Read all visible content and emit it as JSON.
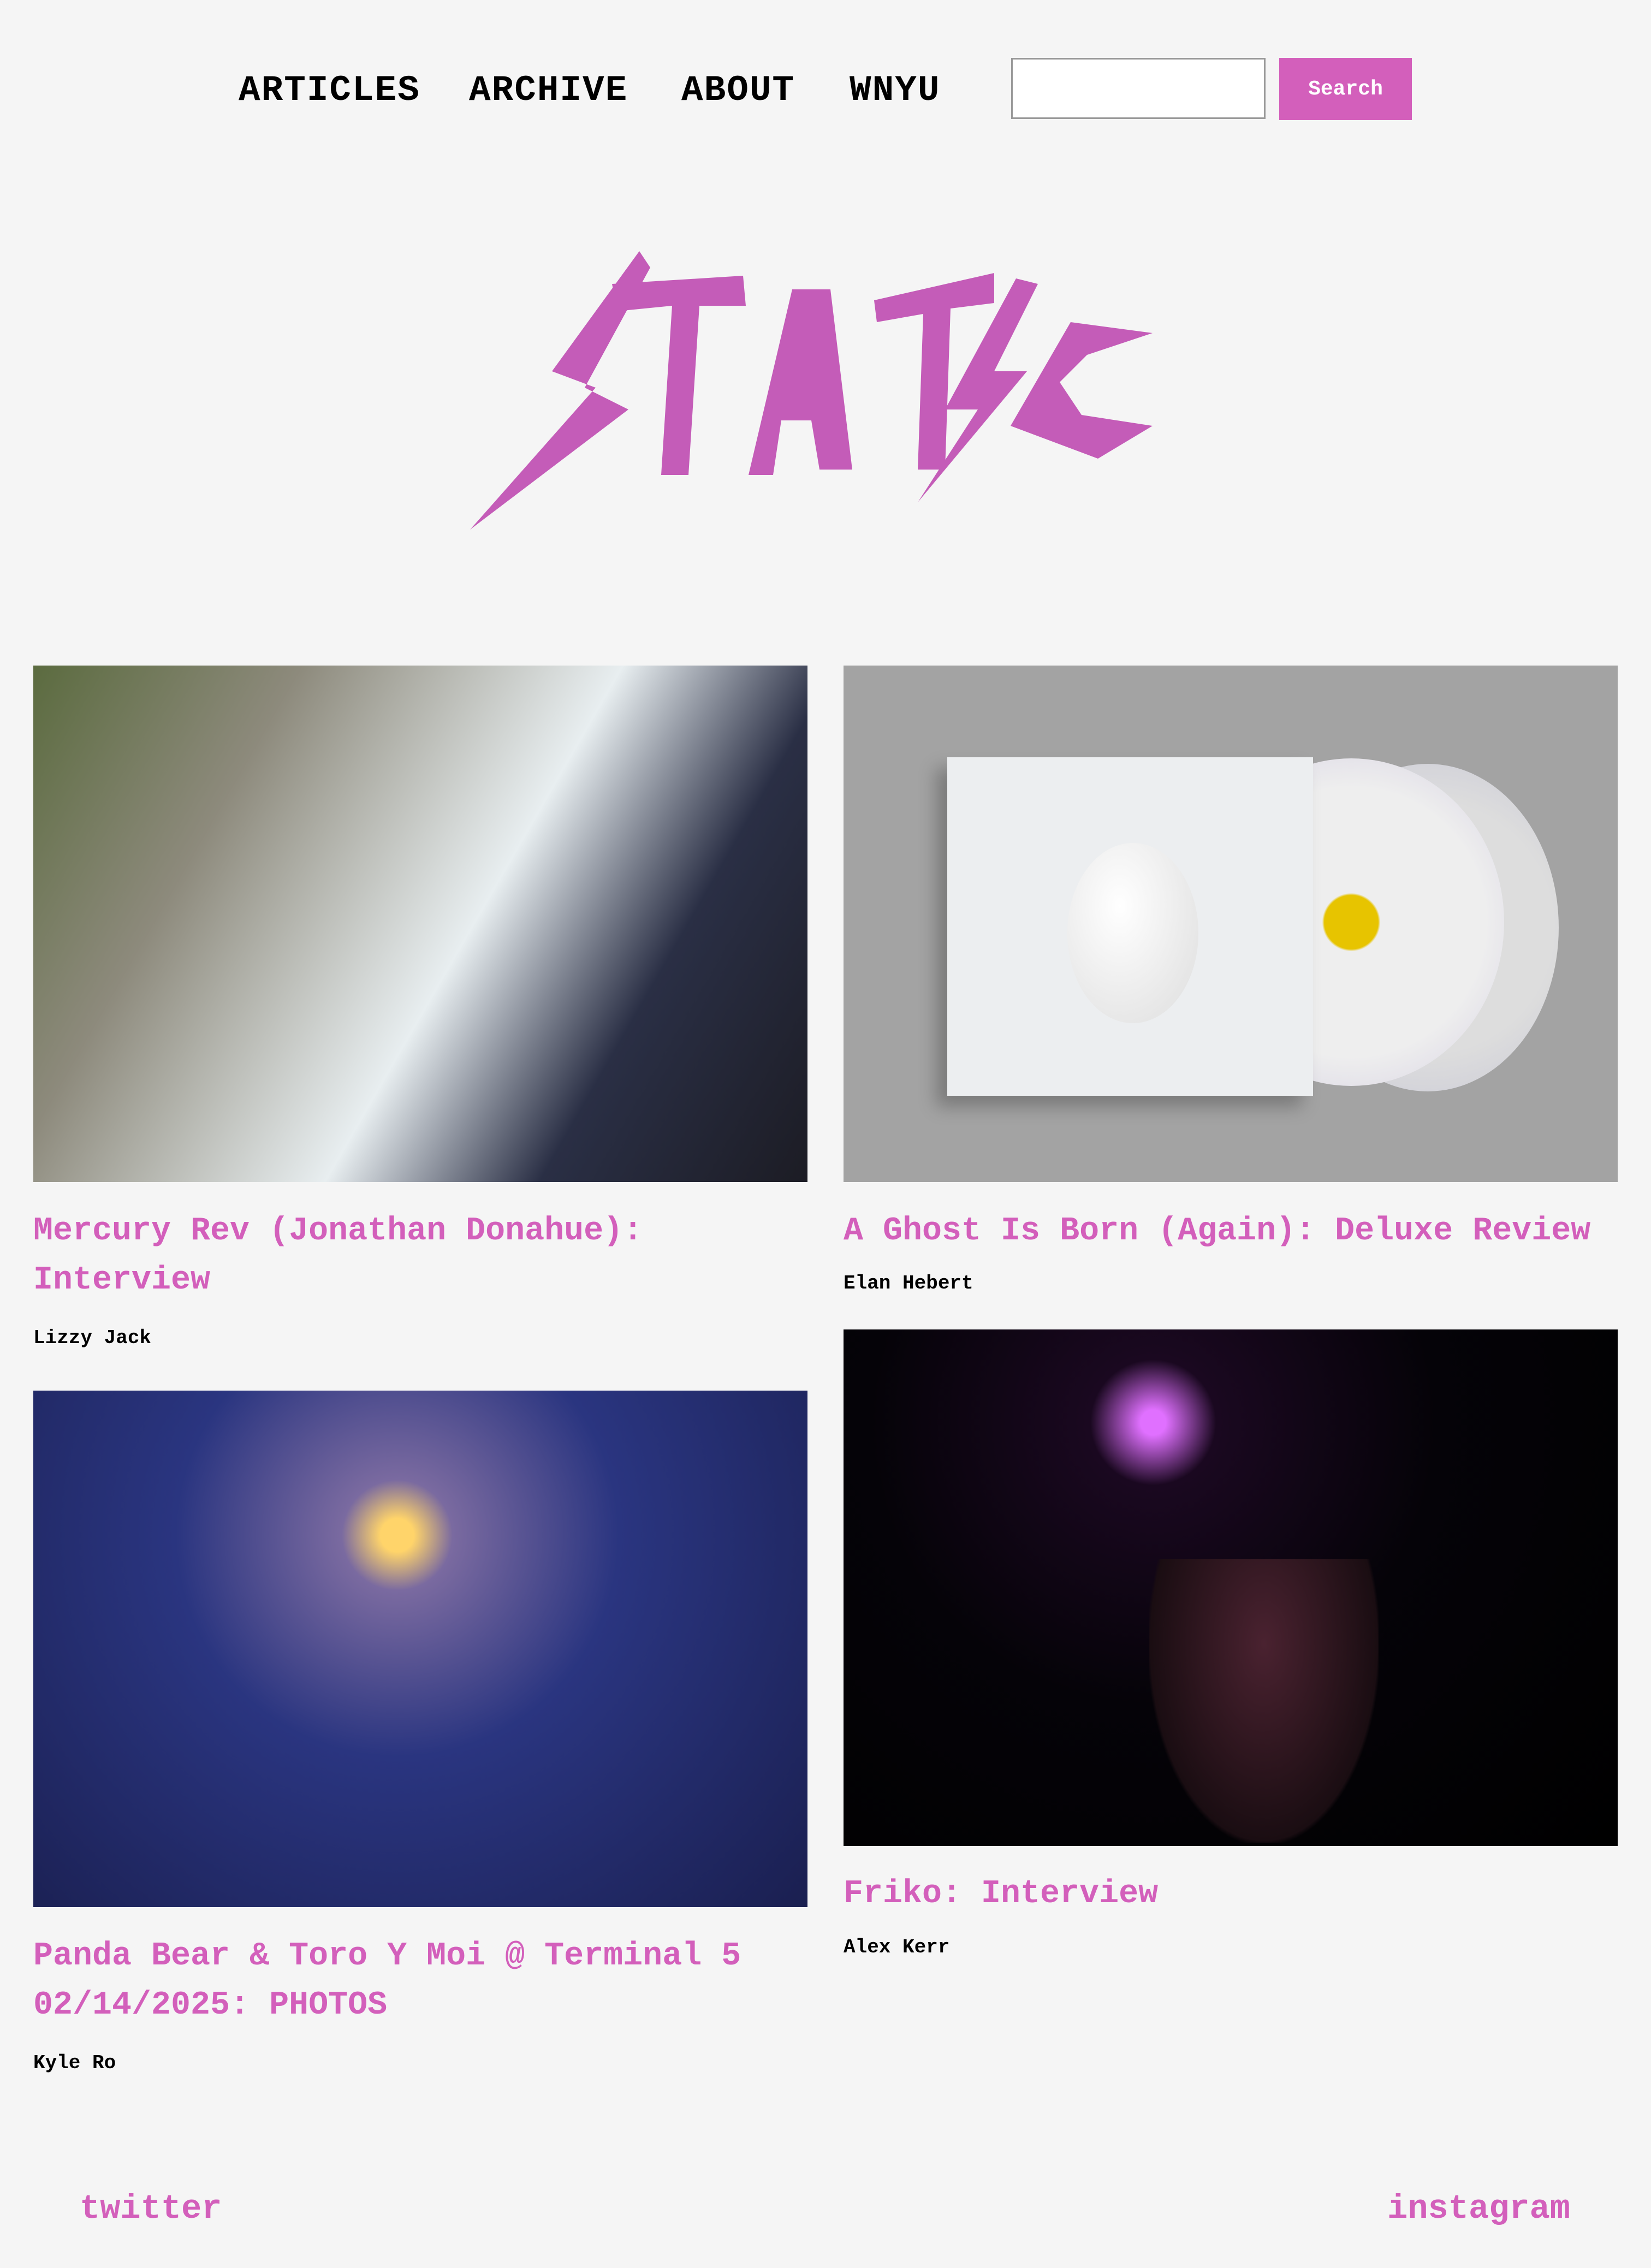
{
  "nav": {
    "items": [
      "ARTICLES",
      "ARCHIVE",
      "ABOUT",
      "WNYU"
    ]
  },
  "search": {
    "value": "",
    "button_label": "Search"
  },
  "logo": {
    "text": "STATIC"
  },
  "articles": [
    {
      "title": "Mercury Rev (Jonathan Donahue): Interview",
      "author": "Lizzy Jack",
      "image": "band-selfie-photo"
    },
    {
      "title": "A Ghost Is Born (Again): Deluxe Review",
      "author": "Elan Hebert",
      "image": "album-cd-photo"
    },
    {
      "title": "Panda Bear & Toro Y Moi @ Terminal 5 02/14/2025: PHOTOS",
      "author": "Kyle Ro",
      "image": "concert-guitarist-blue-photo"
    },
    {
      "title": "Friko: Interview",
      "author": "Alex Kerr",
      "image": "concert-guitarist-dark-photo"
    }
  ],
  "footer": {
    "twitter": "twitter",
    "instagram": "instagram"
  },
  "colors": {
    "accent": "#d35fbb",
    "background": "#f5f5f5"
  }
}
